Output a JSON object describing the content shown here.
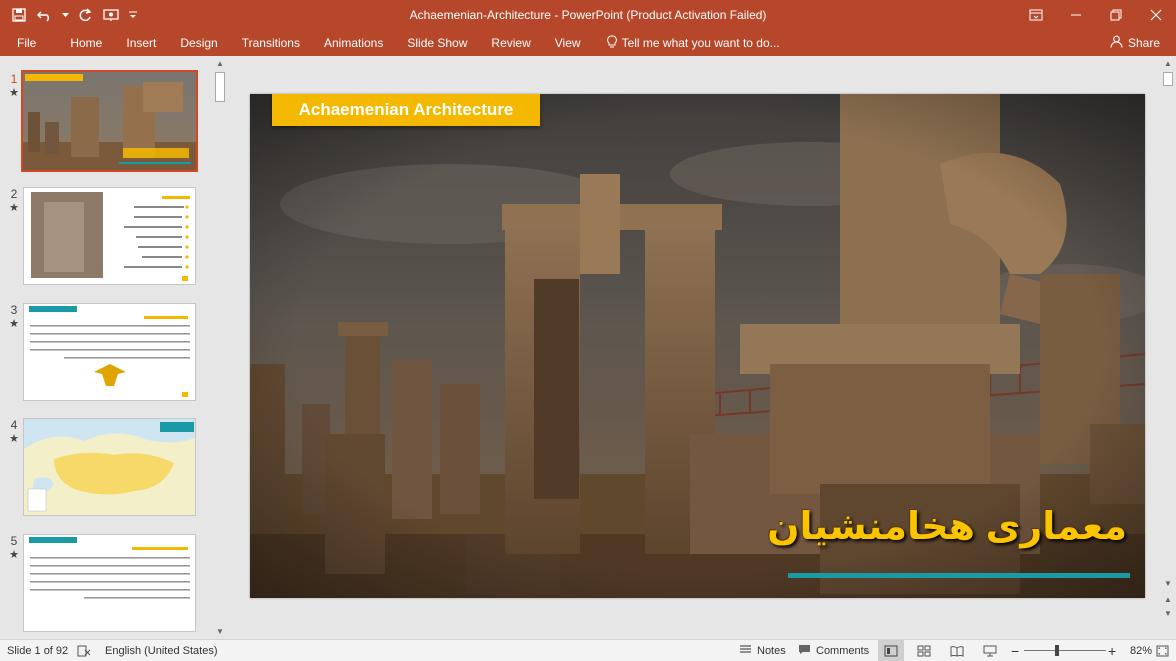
{
  "window": {
    "title": "Achaemenian-Architecture - PowerPoint (Product Activation Failed)"
  },
  "quick_access": [
    "save-icon",
    "undo-icon",
    "redo-icon",
    "start-from-beginning-icon",
    "customize-icon"
  ],
  "ribbon": {
    "tabs": [
      "File",
      "Home",
      "Insert",
      "Design",
      "Transitions",
      "Animations",
      "Slide Show",
      "Review",
      "View"
    ],
    "tell_me": "Tell me what you want to do...",
    "share": "Share"
  },
  "thumbnails": [
    {
      "number": "1",
      "star": "★",
      "selected": true
    },
    {
      "number": "2",
      "star": "★",
      "selected": false
    },
    {
      "number": "3",
      "star": "★",
      "selected": false
    },
    {
      "number": "4",
      "star": "★",
      "selected": false
    },
    {
      "number": "5",
      "star": "★",
      "selected": false
    }
  ],
  "slide": {
    "title": "Achaemenian Architecture",
    "persian_title": "معماری هخامنشیان"
  },
  "status": {
    "slide_counter": "Slide 1 of 92",
    "language": "English (United States)",
    "notes": "Notes",
    "comments": "Comments",
    "zoom_level": "82%",
    "zoom_fraction": 0.82
  },
  "colors": {
    "accent": "#b7472a",
    "selection": "#d24726",
    "slide_title_bg": "#f5b800",
    "slide_rule": "#1a9aa5"
  }
}
